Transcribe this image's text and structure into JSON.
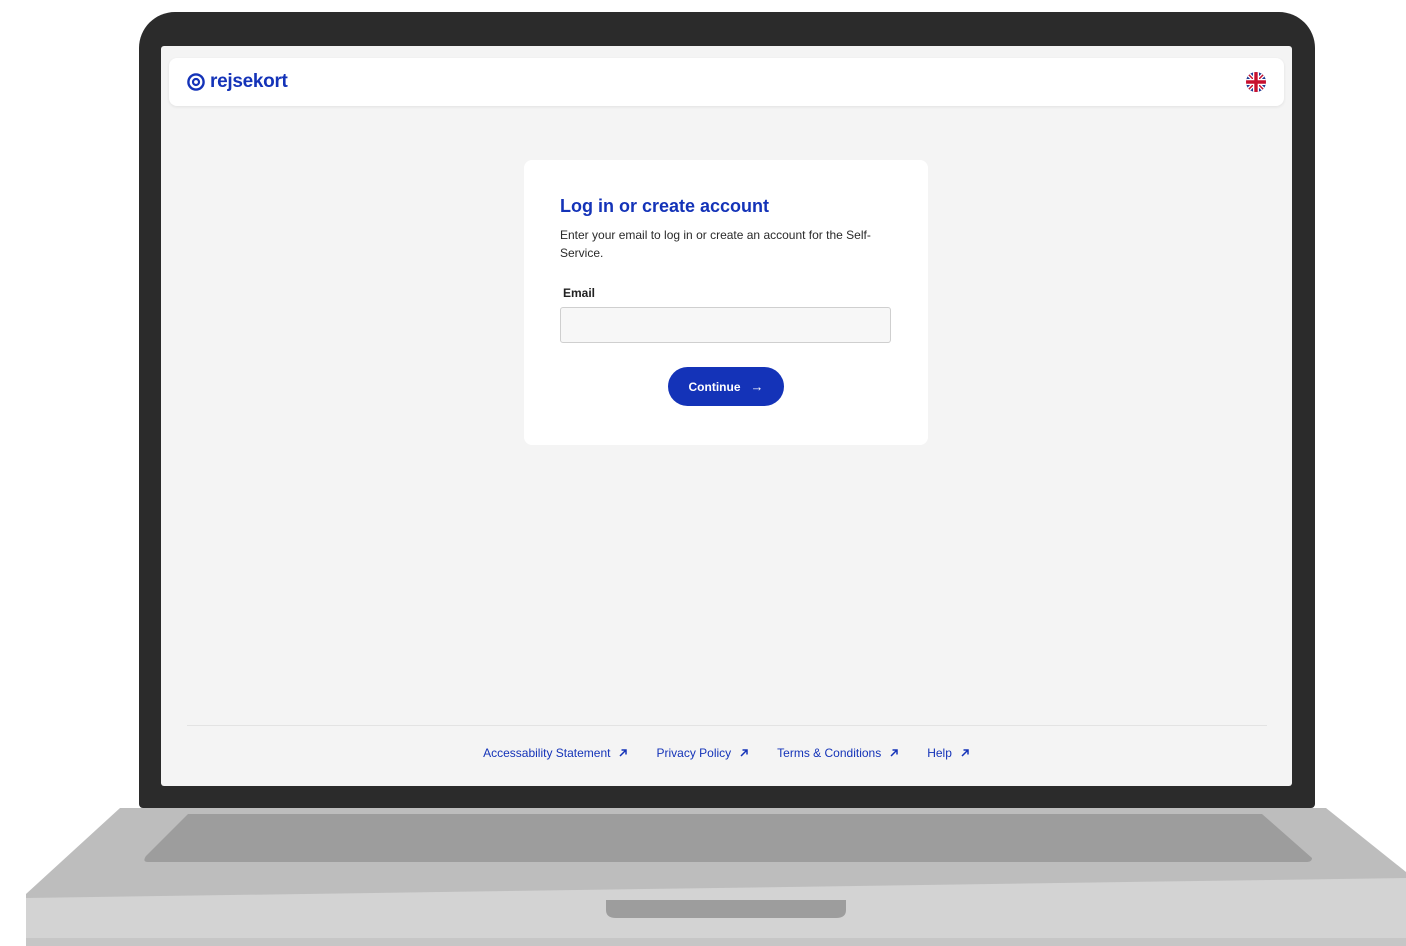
{
  "brand": {
    "name": "rejsekort",
    "color": "#1433b8",
    "logo_icon": "rejsekort-logo-icon"
  },
  "header": {
    "language_icon": "uk-flag-icon"
  },
  "login": {
    "title": "Log in or create account",
    "description": "Enter your email to log in or create an account for the Self-Service.",
    "email_label": "Email",
    "email_value": "",
    "continue_label": "Continue",
    "continue_icon": "arrow-right-icon"
  },
  "footer": {
    "links": [
      {
        "label": "Accessability Statement",
        "icon": "external-link-icon"
      },
      {
        "label": "Privacy Policy",
        "icon": "external-link-icon"
      },
      {
        "label": "Terms & Conditions",
        "icon": "external-link-icon"
      },
      {
        "label": "Help",
        "icon": "external-link-icon"
      }
    ]
  }
}
